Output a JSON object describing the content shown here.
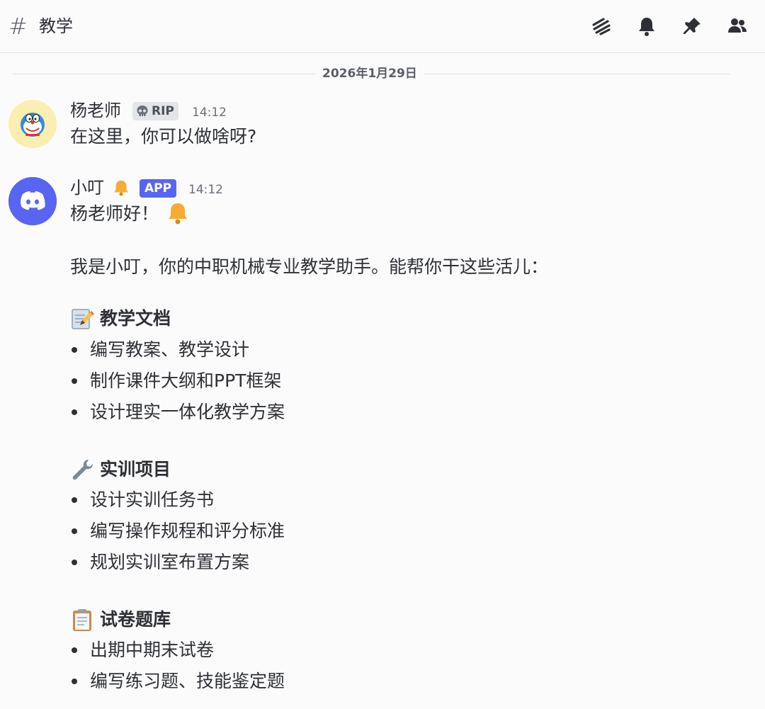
{
  "header": {
    "channel_name": "教学",
    "icons": [
      "threads-icon",
      "bell-icon",
      "pin-icon",
      "members-icon"
    ]
  },
  "date_divider": "2026年1月29日",
  "messages": [
    {
      "author": "杨老师",
      "badge": "RIP",
      "badge_icon": "skull-icon",
      "time": "14:12",
      "text": "在这里，你可以做啥呀?"
    },
    {
      "author": "小叮",
      "author_icon": "bell-emoji",
      "badge": "APP",
      "time": "14:12",
      "greeting": "杨老师好！",
      "intro": "我是小叮，你的中职机械专业教学助手。能帮你干这些活儿：",
      "sections": [
        {
          "emoji": "memo-emoji",
          "title": "教学文档",
          "items": [
            "编写教案、教学设计",
            "制作课件大纲和PPT框架",
            "设计理实一体化教学方案"
          ]
        },
        {
          "emoji": "wrench-emoji",
          "title": "实训项目",
          "items": [
            "设计实训任务书",
            "编写操作规程和评分标准",
            "规划实训室布置方案"
          ]
        },
        {
          "emoji": "clipboard-emoji",
          "title": "试卷题库",
          "items": [
            "出期中期末试卷",
            "编写练习题、技能鉴定题"
          ]
        }
      ]
    }
  ],
  "colors": {
    "background": "#fbfbfc",
    "text": "#2e3035",
    "muted": "#6d6f78",
    "app_badge": "#5865f2",
    "discord_avatar": "#5865f2"
  }
}
